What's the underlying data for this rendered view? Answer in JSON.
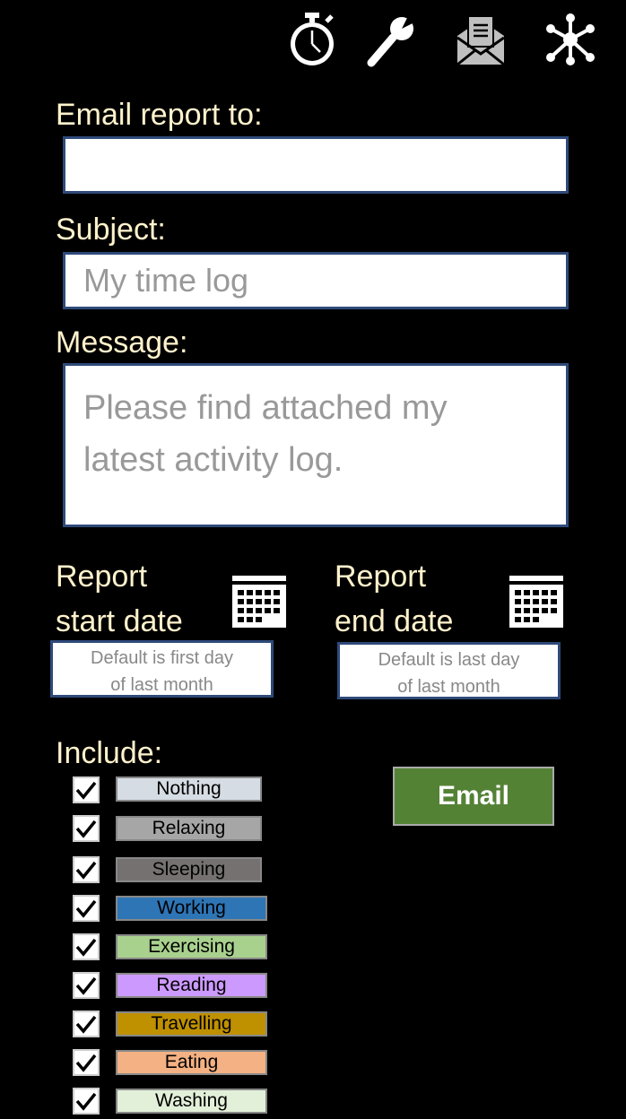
{
  "toolbar": {
    "icons": [
      "stopwatch-icon",
      "wrench-icon",
      "envelope-report-icon",
      "network-icon"
    ]
  },
  "form": {
    "email_label": "Email report to:",
    "email_value": "",
    "subject_label": "Subject:",
    "subject_value": "My time log",
    "message_label": "Message:",
    "message_value": "Please find attached my\nlatest activity log.",
    "start_date_label": "Report\nstart date",
    "start_date_value": "Default is first day\nof last month",
    "end_date_label": "Report\nend date",
    "end_date_value": "Default is last day\nof last month",
    "include_label": "Include:",
    "email_button": "Email"
  },
  "categories": [
    {
      "label": "Nothing",
      "color": "#d6dce4",
      "checked": true
    },
    {
      "label": "Relaxing",
      "color": "#a6a6a6",
      "checked": true
    },
    {
      "label": "Sleeping",
      "color": "#767171",
      "checked": true
    },
    {
      "label": "Working",
      "color": "#2e75b6",
      "checked": true
    },
    {
      "label": "Exercising",
      "color": "#a9d18e",
      "checked": true
    },
    {
      "label": "Reading",
      "color": "#cc99ff",
      "checked": true
    },
    {
      "label": "Travelling",
      "color": "#bf9000",
      "checked": true
    },
    {
      "label": "Eating",
      "color": "#f4b183",
      "checked": true
    },
    {
      "label": "Washing",
      "color": "#e2f0d9",
      "checked": true
    }
  ]
}
